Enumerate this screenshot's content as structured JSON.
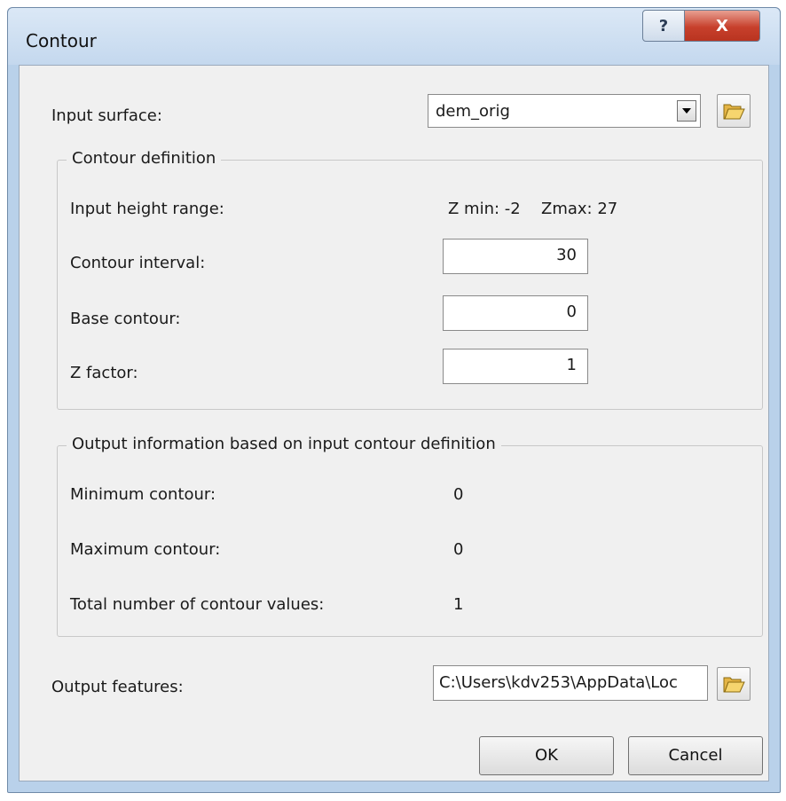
{
  "window": {
    "title": "Contour",
    "help_label": "?",
    "close_label": "X"
  },
  "input_surface": {
    "label": "Input surface:",
    "value": "dem_orig"
  },
  "contour_definition": {
    "legend": "Contour definition",
    "height_range_label": "Input height range:",
    "zmin_text": "Z min:  -2",
    "zmax_text": "Zmax:  27",
    "interval_label": "Contour interval:",
    "interval_value": "30",
    "base_label": "Base contour:",
    "base_value": "0",
    "zfactor_label": "Z factor:",
    "zfactor_value": "1"
  },
  "output_info": {
    "legend": "Output information based on input contour definition",
    "min_label": "Minimum contour:",
    "min_value": "0",
    "max_label": "Maximum contour:",
    "max_value": "0",
    "total_label": "Total number of contour values:",
    "total_value": "1"
  },
  "output_features": {
    "label": "Output features:",
    "value": "C:\\Users\\kdv253\\AppData\\Loc"
  },
  "buttons": {
    "ok": "OK",
    "cancel": "Cancel"
  },
  "icons": {
    "combo_arrow": "dropdown-arrow-icon",
    "folder": "open-folder-icon"
  }
}
